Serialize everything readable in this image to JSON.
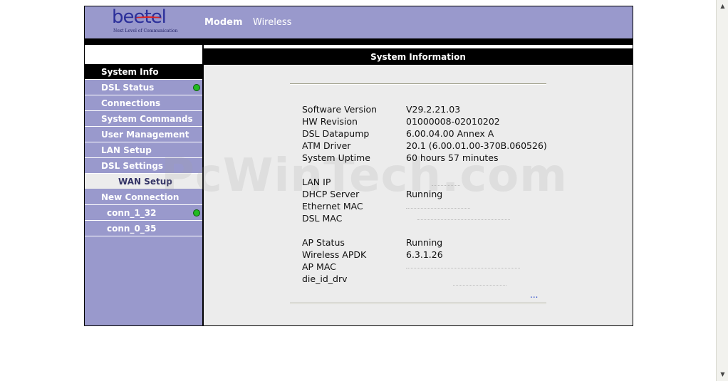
{
  "brand": {
    "logo_text": "beetel",
    "tagline": "Next Level of Communication"
  },
  "topnav": {
    "modem": "Modem",
    "wireless": "Wireless"
  },
  "sidebar": {
    "items": [
      {
        "label": "System Info",
        "active": true
      },
      {
        "label": "DSL Status",
        "status": "green"
      },
      {
        "label": "Connections"
      },
      {
        "label": "System Commands"
      },
      {
        "label": "User Management"
      },
      {
        "label": "LAN Setup"
      },
      {
        "label": "DSL Settings"
      },
      {
        "label": "WAN Setup",
        "sub": true
      },
      {
        "label": "New Connection"
      },
      {
        "label": "conn_1_32",
        "status": "green"
      },
      {
        "label": "conn_0_35"
      }
    ]
  },
  "content": {
    "title": "System Information",
    "group1": [
      {
        "key": "Software Version",
        "value": "V29.2.21.03"
      },
      {
        "key": "HW Revision",
        "value": "01000008-02010202"
      },
      {
        "key": "DSL Datapump",
        "value": "6.00.04.00 Annex A"
      },
      {
        "key": "ATM Driver",
        "value": "20.1 (6.00.01.00-370B.060526)"
      },
      {
        "key": "System Uptime",
        "value": "60 hours 57 minutes"
      }
    ],
    "group2": [
      {
        "key": "LAN IP",
        "value": ""
      },
      {
        "key": "DHCP Server",
        "value": "Running"
      },
      {
        "key": "Ethernet MAC",
        "value": ""
      },
      {
        "key": "DSL MAC",
        "value": ""
      }
    ],
    "group3": [
      {
        "key": "AP Status",
        "value": "Running"
      },
      {
        "key": "Wireless APDK",
        "value": "6.3.1.26"
      },
      {
        "key": "AP MAC",
        "value": ""
      },
      {
        "key": "die_id_drv",
        "value": ""
      }
    ],
    "more_link": "...",
    "watermark": "PcWinTech.com"
  },
  "colors": {
    "header": "#9999cc",
    "sidebar": "#9999cc",
    "content_bg": "#ececec",
    "status_ok": "#22bb22"
  }
}
